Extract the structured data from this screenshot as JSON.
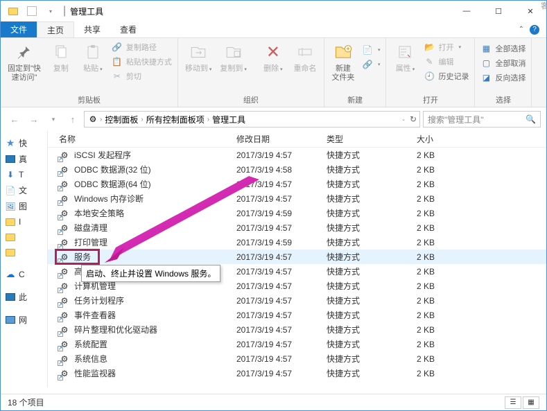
{
  "window": {
    "title": "管理工具"
  },
  "winControls": {
    "min": "—",
    "max": "☐",
    "close": "✕"
  },
  "tabs": {
    "file": "文件",
    "home": "主页",
    "share": "共享",
    "view": "查看"
  },
  "ribbon": {
    "pin": {
      "label": "固定到\"快\n速访问\""
    },
    "copy": "复制",
    "paste": "粘贴",
    "copyPath": "复制路径",
    "pasteShortcut": "粘贴快捷方式",
    "cut": "剪切",
    "clipboard": "剪贴板",
    "moveTo": "移动到",
    "copyTo": "复制到",
    "delete": "删除",
    "rename": "重命名",
    "organize": "组织",
    "newFolder": "新建\n文件夹",
    "new": "新建",
    "properties": "属性",
    "openItem": "打开",
    "edit": "编辑",
    "history": "历史记录",
    "open": "打开",
    "selectAll": "全部选择",
    "selectNone": "全部取消",
    "invert": "反向选择",
    "select": "选择"
  },
  "breadcrumb": {
    "items": [
      "控制面板",
      "所有控制面板项",
      "管理工具"
    ],
    "searchPlaceholder": "搜索\"管理工具\""
  },
  "columns": {
    "name": "名称",
    "date": "修改日期",
    "type": "类型",
    "size": "大小"
  },
  "tree": {
    "quick": "快",
    "this": "此",
    "net": "网"
  },
  "files": [
    {
      "name": "iSCSI 发起程序",
      "date": "2017/3/19 4:57",
      "type": "快捷方式",
      "size": "2 KB"
    },
    {
      "name": "ODBC 数据源(32 位)",
      "date": "2017/3/19 4:58",
      "type": "快捷方式",
      "size": "2 KB"
    },
    {
      "name": "ODBC 数据源(64 位)",
      "date": "2017/3/19 4:57",
      "type": "快捷方式",
      "size": "2 KB"
    },
    {
      "name": "Windows 内存诊断",
      "date": "2017/3/19 4:57",
      "type": "快捷方式",
      "size": "2 KB"
    },
    {
      "name": "本地安全策略",
      "date": "2017/3/19 4:59",
      "type": "快捷方式",
      "size": "2 KB"
    },
    {
      "name": "磁盘清理",
      "date": "2017/3/19 4:57",
      "type": "快捷方式",
      "size": "2 KB"
    },
    {
      "name": "打印管理",
      "date": "2017/3/19 4:59",
      "type": "快捷方式",
      "size": "2 KB"
    },
    {
      "name": "服务",
      "date": "2017/3/19 4:57",
      "type": "快捷方式",
      "size": "2 KB"
    },
    {
      "name": "高级安全",
      "date": "2017/3/19 4:57",
      "type": "快捷方式",
      "size": "2 KB"
    },
    {
      "name": "计算机管理",
      "date": "2017/3/19 4:57",
      "type": "快捷方式",
      "size": "2 KB"
    },
    {
      "name": "任务计划程序",
      "date": "2017/3/19 4:57",
      "type": "快捷方式",
      "size": "2 KB"
    },
    {
      "name": "事件查看器",
      "date": "2017/3/19 4:57",
      "type": "快捷方式",
      "size": "2 KB"
    },
    {
      "name": "碎片整理和优化驱动器",
      "date": "2017/3/19 4:57",
      "type": "快捷方式",
      "size": "2 KB"
    },
    {
      "name": "系统配置",
      "date": "2017/3/19 4:57",
      "type": "快捷方式",
      "size": "2 KB"
    },
    {
      "name": "系统信息",
      "date": "2017/3/19 4:57",
      "type": "快捷方式",
      "size": "2 KB"
    },
    {
      "name": "性能监视器",
      "date": "2017/3/19 4:57",
      "type": "快捷方式",
      "size": "2 KB"
    }
  ],
  "tooltip": "启动、终止并设置 Windows 服务。",
  "status": {
    "count": "18 个项目"
  }
}
